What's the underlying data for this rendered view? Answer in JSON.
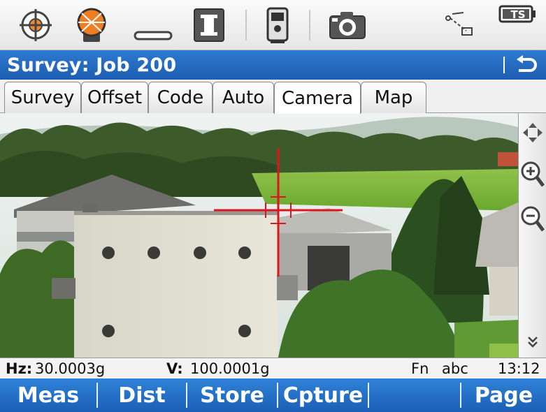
{
  "statusbar": {
    "icons": [
      "crosshair-target-icon",
      "prism-icon",
      "keyboard-cursor-icon",
      "instrument-i-icon",
      "total-station-icon",
      "camera-icon",
      "line-measure-icon",
      "battery-icon"
    ],
    "battery_label": "TS"
  },
  "titlebar": {
    "title": "Survey: Job 200",
    "back_icon": "back-arrow-icon"
  },
  "tabs": [
    {
      "label": "Survey",
      "active": false
    },
    {
      "label": "Offset",
      "active": false
    },
    {
      "label": "Code",
      "active": false
    },
    {
      "label": "Auto",
      "active": false
    },
    {
      "label": "Camera",
      "active": true
    },
    {
      "label": "Map",
      "active": false
    }
  ],
  "sidepanel": {
    "icons": [
      "pan-arrows-icon",
      "zoom-in-icon",
      "zoom-out-icon",
      "double-chevron-down-icon"
    ]
  },
  "info": {
    "hz_label": "Hz:",
    "hz_value": "30.0003g",
    "v_label": "V:",
    "v_value": "100.0001g",
    "fn": "Fn",
    "input_mode": "abc",
    "time": "13:12"
  },
  "softkeys": [
    "Meas",
    "Dist",
    "Store",
    "Cpture",
    "",
    "Page"
  ],
  "colors": {
    "accent_blue": "#1d5db0",
    "crosshair_red": "#e0141e"
  }
}
